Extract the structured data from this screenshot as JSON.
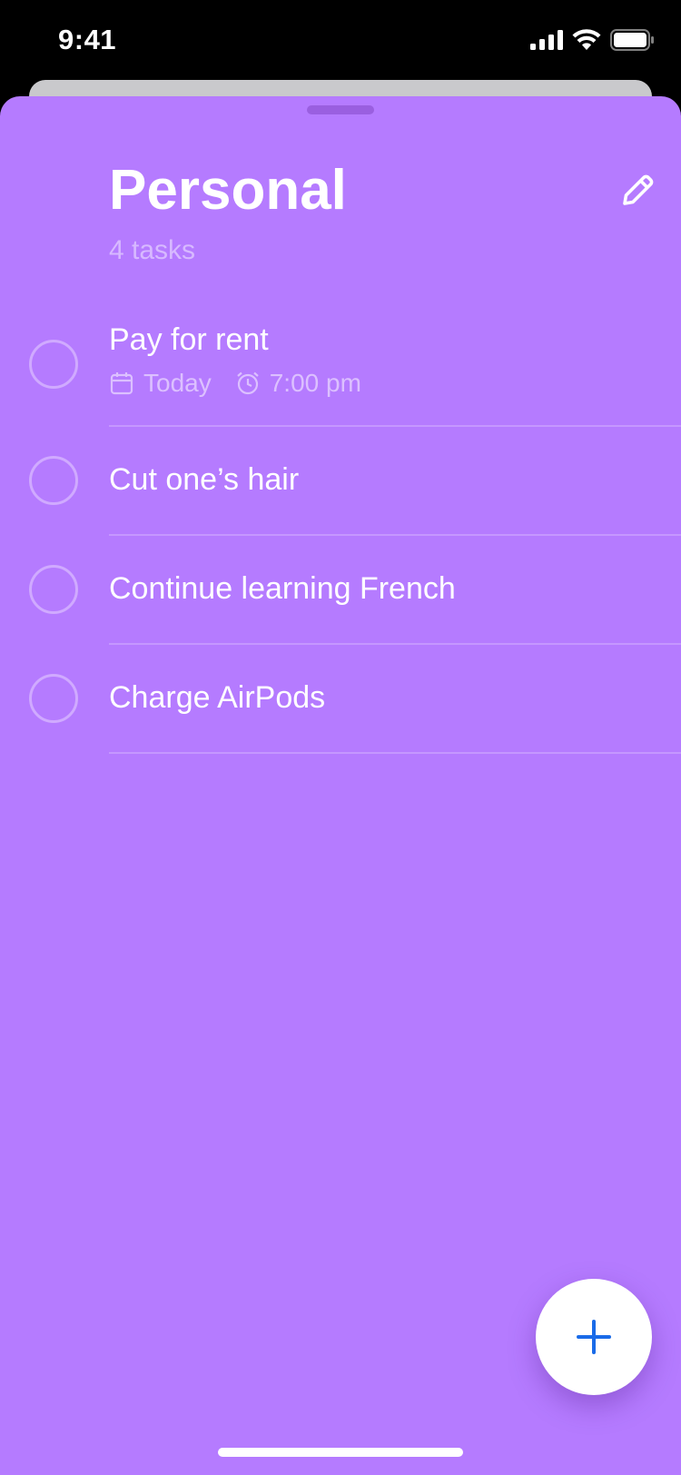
{
  "status_bar": {
    "time": "9:41",
    "icons": [
      "cellular-signal-icon",
      "wifi-icon",
      "battery-icon"
    ]
  },
  "list": {
    "title": "Personal",
    "subtitle": "4 tasks",
    "edit_icon": "pencil-icon",
    "accent_color": "#b57bff"
  },
  "tasks": [
    {
      "title": "Pay for rent",
      "due_date": "Today",
      "due_time": "7:00 pm",
      "date_icon": "calendar-icon",
      "time_icon": "alarm-clock-icon"
    },
    {
      "title": "Cut one’s hair"
    },
    {
      "title": "Continue learning French"
    },
    {
      "title": "Charge AirPods"
    }
  ],
  "fab": {
    "icon": "plus-icon",
    "icon_color": "#1a6be8"
  }
}
